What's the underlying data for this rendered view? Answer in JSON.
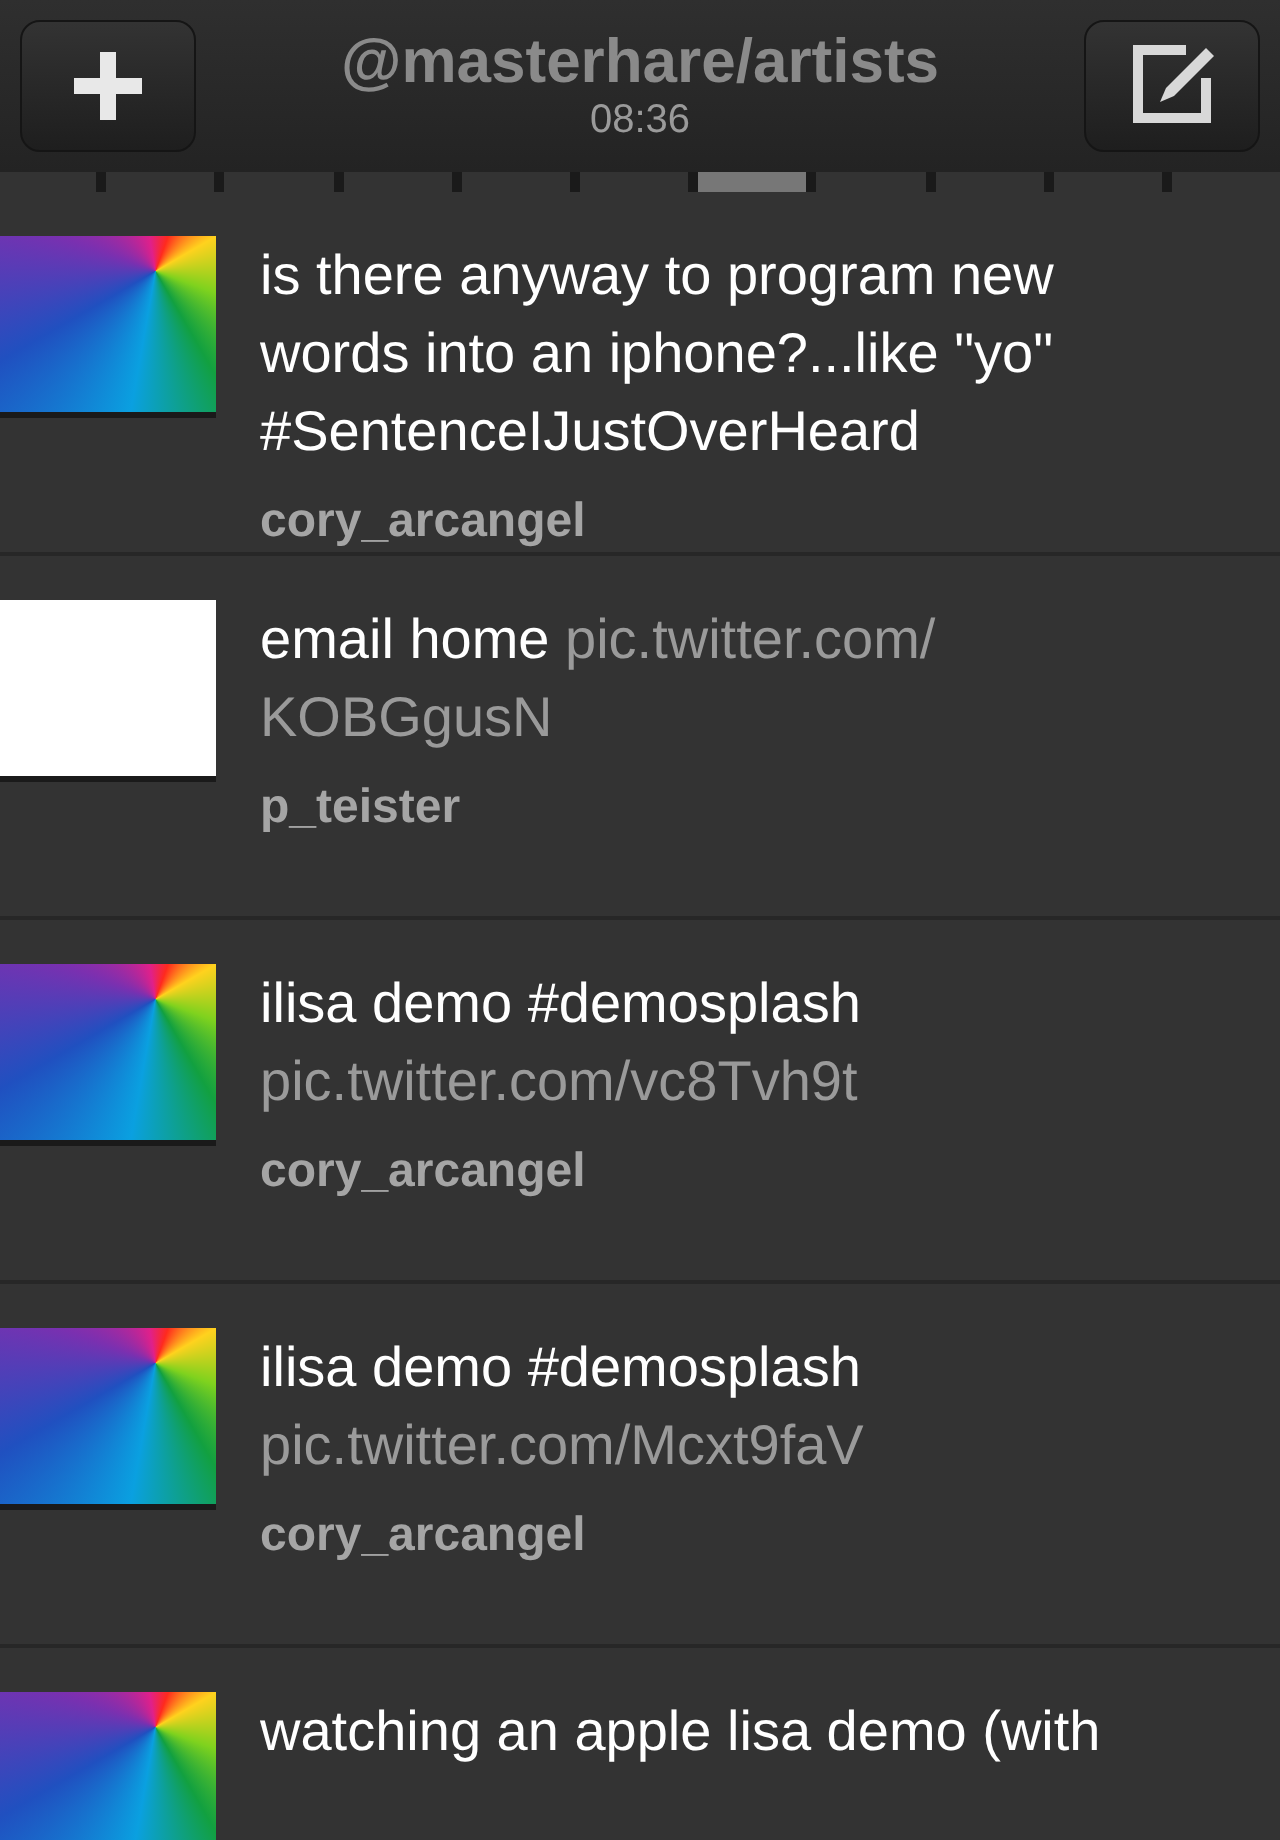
{
  "header": {
    "title": "@masterhare/artists",
    "time": "08:36"
  },
  "pages": [
    {
      "selected": false
    },
    {
      "selected": false
    },
    {
      "selected": false
    },
    {
      "selected": false
    },
    {
      "selected": false
    },
    {
      "selected": false
    },
    {
      "selected": true
    },
    {
      "selected": false
    },
    {
      "selected": false
    },
    {
      "selected": false
    },
    {
      "selected": false
    }
  ],
  "tweets": [
    {
      "kind": "spectrum",
      "parts": [
        {
          "kind": "plain",
          "text": "is there anyway to program new words into an iphone?...like \"yo\" #SentenceIJustOverHeard"
        }
      ],
      "user": "cory_arcangel"
    },
    {
      "kind": "blank",
      "parts": [
        {
          "kind": "plain",
          "text": "email home"
        },
        {
          "kind": "link",
          "text": "pic.twitter.com/"
        },
        {
          "kind": "link",
          "text": "KOBGgusN"
        }
      ],
      "user": "p_teister"
    },
    {
      "kind": "spectrum",
      "parts": [
        {
          "kind": "plain",
          "text": "ilisa demo #demosplash"
        },
        {
          "kind": "link",
          "text": "pic.twitter.com/vc8Tvh9t"
        }
      ],
      "user": "cory_arcangel"
    },
    {
      "kind": "spectrum",
      "parts": [
        {
          "kind": "plain",
          "text": "ilisa demo #demosplash"
        },
        {
          "kind": "link",
          "text": "pic.twitter.com/Mcxt9faV"
        }
      ],
      "user": "cory_arcangel"
    },
    {
      "kind": "spectrum",
      "parts": [
        {
          "kind": "plain",
          "text": "watching an apple lisa demo (with"
        }
      ]
    }
  ]
}
